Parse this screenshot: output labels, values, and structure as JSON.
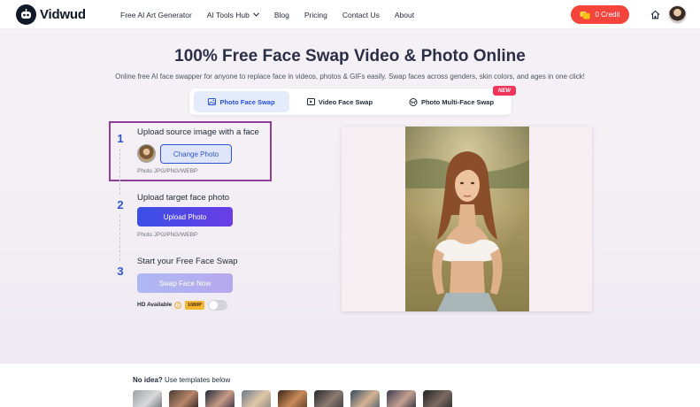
{
  "brand": {
    "name": "Vidwud"
  },
  "nav": {
    "items": [
      {
        "label": "Free AI Art Generator"
      },
      {
        "label": "AI Tools Hub",
        "has_dropdown": true
      },
      {
        "label": "Blog"
      },
      {
        "label": "Pricing"
      },
      {
        "label": "Contact Us"
      },
      {
        "label": "About"
      }
    ],
    "credit": {
      "label": "0 Credit",
      "color": "#f5443b"
    }
  },
  "hero": {
    "title": "100% Free Face Swap Video & Photo Online",
    "subtitle": "Online free AI face swapper for anyone to replace face in videos, photos & GIFs easily. Swap faces across genders, skin colors, and ages in one click!"
  },
  "tabs": [
    {
      "label": "Photo Face Swap",
      "icon": "image-icon",
      "active": true
    },
    {
      "label": "Video Face Swap",
      "icon": "video-icon",
      "active": false
    },
    {
      "label": "Photo Multi-Face Swap",
      "icon": "multi-face-icon",
      "active": false,
      "badge": "NEW"
    }
  ],
  "steps": [
    {
      "number": "1",
      "title": "Upload source image with a face",
      "button": "Change Photo",
      "hint": "Photo JPG/PNG/WEBP"
    },
    {
      "number": "2",
      "title": "Upload target face photo",
      "button": "Upload Photo",
      "hint": "Photo JPG/PNG/WEBP"
    },
    {
      "number": "3",
      "title": "Start your Free Face Swap",
      "button": "Swap Face Now"
    }
  ],
  "hd": {
    "label": "HD Available",
    "badge": "1080P",
    "enabled": false
  },
  "templates": {
    "bold": "No idea?",
    "rest": " Use templates below"
  },
  "colors": {
    "accent": "#2f55d4",
    "highlight_border": "#8f3f9a",
    "new_badge": "#f0345a",
    "hd_badge": "#f5b731"
  }
}
